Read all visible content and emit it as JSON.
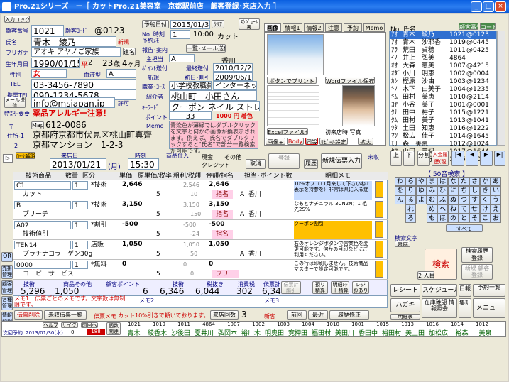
{
  "window": {
    "title": "Pro.21シリーズ　－［ カットPro.21美容室　京都駅前店　顧客登録･来店入力 ］",
    "min_label": "_",
    "max_label": "□",
    "close_label": "×"
  },
  "customer": {
    "header_btn": "入力ロック",
    "id_label": "顧客番号",
    "id": "1021",
    "code_label": "顧客ｺｰﾄﾞ",
    "code": "@0123",
    "name_label": "氏名",
    "name": "青木　綾乃",
    "tag_new": "新規",
    "furigana_label": "フリガナ",
    "furigana": "アオキ アヤノご家族",
    "renraku": "連名",
    "birth_label": "生年月日",
    "birth": "1990/01/15",
    "era": "平",
    "era_year": "2",
    "age": "23",
    "age_unit": "歳",
    "months": "4",
    "months_unit": "ヶ月",
    "gender_label": "性別",
    "gender": "女",
    "blood_label": "血液型",
    "blood": "A",
    "tel_label": "TEL",
    "tel": "03-3456-7890",
    "mobile_label": "携帯TEL",
    "mobile": "090-1234-5678",
    "mail_btn": "メール送信",
    "email": "info@msjapan.jp",
    "permit_label": "許可",
    "note_label": "特記･要要",
    "note": "薬品アレルギー注意！",
    "zip_label": "〒",
    "map_btn": "Map",
    "zip": "612-0086",
    "addr_label": "住所-1",
    "addr1": "京都府京都市伏見区桃山町真齊",
    "addr2": "京都マンション　1-2-3",
    "addr2_label": "2"
  },
  "reservation": {
    "yoyaku_btn": "予約日付",
    "date": "2015/01/31",
    "clear_btn": "ｸﾘｱ",
    "sched_btn": "ｽｹｼﾞｭｰﾙ表",
    "no_label": "No. 時刻",
    "yoyaku_memo_label": "予約ﾒﾓ",
    "no": "1",
    "time": "10:00",
    "menu": "カット",
    "contact_label": "報告･案内",
    "mail_btn": "一覧･メール送信",
    "staff_label": "主担当",
    "staff_code": "A",
    "staff_name": "香川",
    "point_label": "ﾎﾟｲﾝﾄ送付",
    "last_visit_label": "最終送付",
    "last_visit": "2010/12/20",
    "new_label": "新規",
    "first_visit_label": "初日･割引",
    "first_visit": "2009/06/10",
    "job_label": "職業･ｺｰｽ",
    "job": "小学校教職員",
    "source": "インターネット",
    "intro_label": "紹介者",
    "intro": "桃山町　小田さん",
    "keyword_label": "ｷｰﾜｰﾄﾞ",
    "keyword": "クーポン ネイル ストレート",
    "points_label": "ポイント",
    "points": "33",
    "points_yen": "1000 円 着色",
    "memo_label": "Memo",
    "memo": "青染色が薄緑ではダブルクリックを文字と何かの画像が換表示されます。例えば、氏名でダブルクリックすると\"氏名\"で部分一覧検索が可能です。"
  },
  "tabs": [
    "画像",
    "情報1",
    "情報2",
    "注意",
    "予約",
    "Memo"
  ],
  "image_panel": {
    "print_btn": "ボタンでプリント",
    "word_btn": "Wordファイル保存",
    "excel_btn": "Excelファイル保存",
    "date_label": "初来店時 写真",
    "buttons": [
      "画像+",
      "Body",
      "同設",
      "ﾘﾋﾞｰﾙ設定",
      "拡大"
    ]
  },
  "search": {
    "header": "No. 氏名",
    "code_btn": "顧客番号",
    "code_btn2": "コード",
    "rows": [
      {
        "k": "ｱｵ",
        "name": "青木　綾乃",
        "n": "1021",
        "c": "@0123"
      },
      {
        "k": "ｱｵ",
        "name": "青木　沙耶香",
        "n": "1019",
        "c": "@0445"
      },
      {
        "k": "ｱﾗ",
        "name": "荒田　貞穂",
        "n": "1011",
        "c": "@0425"
      },
      {
        "k": "ｲﾉ",
        "name": "井上　弘美",
        "n": "4864",
        "c": ""
      },
      {
        "k": "ｵｵ",
        "name": "大森　恵美",
        "n": "1007",
        "c": "@4215"
      },
      {
        "k": "ｵﾀﾞ",
        "name": "小川　明恵",
        "n": "1002",
        "c": "@0004"
      },
      {
        "k": "ｶｼ",
        "name": "樫原　沙由",
        "n": "1003",
        "c": "@1234"
      },
      {
        "k": "ｷﾉ",
        "name": "木下　由美子",
        "n": "1004",
        "c": "@1235"
      },
      {
        "k": "ｷﾑ",
        "name": "田村　美恵",
        "n": "1010",
        "c": "@2114"
      },
      {
        "k": "ｺﾔ",
        "name": "小谷　美子",
        "n": "1001",
        "c": "@0001"
      },
      {
        "k": "ﾀﾅ",
        "name": "田中　裕子",
        "n": "1015",
        "c": "@1221"
      },
      {
        "k": "ﾀﾑ",
        "name": "田村　美子",
        "n": "1013",
        "c": "@1041"
      },
      {
        "k": "ﾂﾀ",
        "name": "土田　知恵",
        "n": "1016",
        "c": "@1222"
      },
      {
        "k": "ﾏﾂ",
        "name": "松広　佳子",
        "n": "1014",
        "c": "@1645"
      },
      {
        "k": "ﾓﾘ",
        "name": "森　美恵",
        "n": "1012",
        "c": "@1024"
      },
      {
        "k": "ﾔﾏ",
        "name": "山田　美紀",
        "n": "1017",
        "c": "@1644"
      },
      {
        "k": "ﾖｼ",
        "name": "吉田　花子",
        "n": "1005",
        "c": "@1015"
      }
    ]
  },
  "nav": {
    "first": "|◀",
    "prev": "◀",
    "next": "▶",
    "last": "▶|",
    "up_btn": "上",
    "down_btn": "下",
    "count_btn": "分割",
    "new_visit": "入金履歴(現金)",
    "kana_header": "【 50音検索 】",
    "kana": [
      "わ",
      "ら",
      "や",
      "ま",
      "は",
      "な",
      "た",
      "さ",
      "か",
      "あ",
      "を",
      "り",
      "ゆ",
      "み",
      "ひ",
      "に",
      "ち",
      "し",
      "き",
      "い",
      "ん",
      "る",
      "よ",
      "む",
      "ふ",
      "ぬ",
      "つ",
      "す",
      "く",
      "う",
      "",
      "れ",
      "",
      "め",
      "へ",
      "ね",
      "て",
      "せ",
      "け",
      "え",
      "",
      "ろ",
      "",
      "も",
      "ほ",
      "の",
      "と",
      "そ",
      "こ",
      "お"
    ],
    "all_btn": "すべて",
    "condition_label": "検索文字",
    "history_label": "履歴",
    "search_btn": "検索",
    "search_hist_btn": "検索履歴 登録",
    "new_btn": "新規 顧客登録",
    "two_btn": "2 人目"
  },
  "visit": {
    "lock_btn": "ﾛｯｸ解除",
    "label_date": "来店日",
    "date": "2013/01/21",
    "weekday": "(月)",
    "label_time": "時刻",
    "time": "15:30",
    "label_product": "商品仕入",
    "cash_label": "現金",
    "other_label": "その他",
    "credit_label": "クレジット",
    "cancel_btn": "取消",
    "register_btn": "登録",
    "history_btn": "履歴",
    "new_slip_btn": "新規伝票入力",
    "unpaid_label": "未収"
  },
  "table": {
    "headers": {
      "item": "技術商品",
      "qty": "数量",
      "div": "区分",
      "price": "単価",
      "cost": "原単価/税率",
      "profit": "粗利/税額",
      "amount": "金額/指名",
      "staff": "担当･ポイント数",
      "memo": "明細メモ"
    },
    "rows": [
      {
        "code": "C1",
        "name": "カット",
        "qty": "1",
        "div": "*技術",
        "price": "2,646",
        "rate": "5",
        "profit": "2,546",
        "profit2": "10",
        "amount": "2,646",
        "shimei": "指名",
        "staffc": "A",
        "staff": "香川",
        "memo": "10%オフ（11月来して下さいね♪表示を持参を）非常は県に入る症",
        "memocls": "blue"
      },
      {
        "code": "B",
        "name": "ブリーチ",
        "qty": "1",
        "div": "*技術",
        "price": "3,150",
        "rate": "5",
        "profit": "3,150",
        "profit2": "150",
        "amount": "3,150",
        "shimei": "指名",
        "staffc": "A",
        "staff": "香川",
        "memo": "なもとナチュラル 3CN2N：1 毛先2S%",
        "memocls": ""
      },
      {
        "code": "A02",
        "name": "技術値引",
        "qty": "1",
        "div": "*割引",
        "price": "-500",
        "rate": "5",
        "profit": "-500",
        "profit2": "-24",
        "amount": "-500",
        "shimei": "指名",
        "staffc": "",
        "staff": "",
        "memo": "クーポン割引",
        "memocls": "orange"
      },
      {
        "code": "TEN14",
        "name": "プラチナコラーゲン30g",
        "qty": "1",
        "div": "店販",
        "price": "1,050",
        "rate": "5",
        "profit": "1,050",
        "profit2": "50",
        "amount": "1,050",
        "shimei": "",
        "staffc": "A",
        "staff": "香川",
        "memo": "右のオレンジボタンで営業色を変更可能です。何かの目印などにご利用ください。",
        "memocls": ""
      },
      {
        "code": "0000",
        "name": "コーピーサービス",
        "qty": "1",
        "div": "*無料",
        "price": "0",
        "rate": "5",
        "profit": "0",
        "profit2": "0",
        "amount": "0",
        "shimei": "フリー",
        "staffc": "",
        "staff": "",
        "memo": "この行は印刷しません。技術商品マスターで設定可能です。",
        "memocls": ""
      }
    ]
  },
  "totals": {
    "tech_label": "技術",
    "tech": "5,296",
    "prod_label": "商品その他",
    "prod": "1,050",
    "pt_label": "顧客ポイント",
    "pt": "6",
    "sum_label": "技術",
    "sum": "6,346",
    "tax_label": "税抜き",
    "tax_ex": "6,044",
    "tax_amt_label": "消費税",
    "tax_amt": "302",
    "total_label": "伝票計",
    "total": "6,346",
    "slip_btn": "伝票計 編引",
    "pay_btn": "預り 精算",
    "receipt_btn": "明細ﾚｼｰﾄ 精算",
    "change_btn": "レジ おあり"
  },
  "memo": {
    "memo1_label": "メモ1",
    "memo1": "メモ1　伝票ごとのメモです。文字数は無制限です。",
    "memo2_label": "メモ2",
    "memo3_label": "メモ3",
    "slip_delete": "伝票削除",
    "unpaid_list": "未収伝票一覧",
    "slip_memo_label": "伝票メモ",
    "slip_memo": "カット10%引きで頼いております。",
    "visit_count_label": "来店回数",
    "visit_count": "3",
    "new_label": "新客",
    "prev_btn": "前回",
    "latest_btn": "最近",
    "history_edit": "履歴修正"
  },
  "side_buttons": {
    "or": "OR",
    "bill": "売掛 管理",
    "cust": "顧客 管理",
    "master": "各種 管理",
    "info": "情報 印刷"
  },
  "right_bottom": {
    "receipt": "レシート",
    "schedule": "スケジュール",
    "daily": "日報",
    "reserve_list": "予約一覧",
    "postcard": "ハガキ",
    "stock": "在庫確認 情報照会",
    "total": "集計",
    "menu": "メニュー",
    "payment": "精算",
    "manage": "明細表"
  },
  "bottom": {
    "help": "ヘルプ",
    "side": "サイクル",
    "side2": "前回へ",
    "next_label": "次回予約",
    "next_date": "2013/01/30(水)",
    "counter": "0",
    "counter2": "188",
    "rank_label": "個数 関連",
    "codes": [
      "1021",
      "1019",
      "1011",
      "4864",
      "1007",
      "1002",
      "1003",
      "1004",
      "1010",
      "1001",
      "1015",
      "1013",
      "1016",
      "1014",
      "1012"
    ],
    "names": [
      "青木",
      "綾香木",
      "沙後田",
      "夏井川",
      "弘岡本",
      "裕川木",
      "明奥田",
      "寛押田",
      "福田村",
      "美田川",
      "香田中",
      "裕田村",
      "美土田",
      "加松広",
      "裕森",
      "美泉"
    ]
  }
}
